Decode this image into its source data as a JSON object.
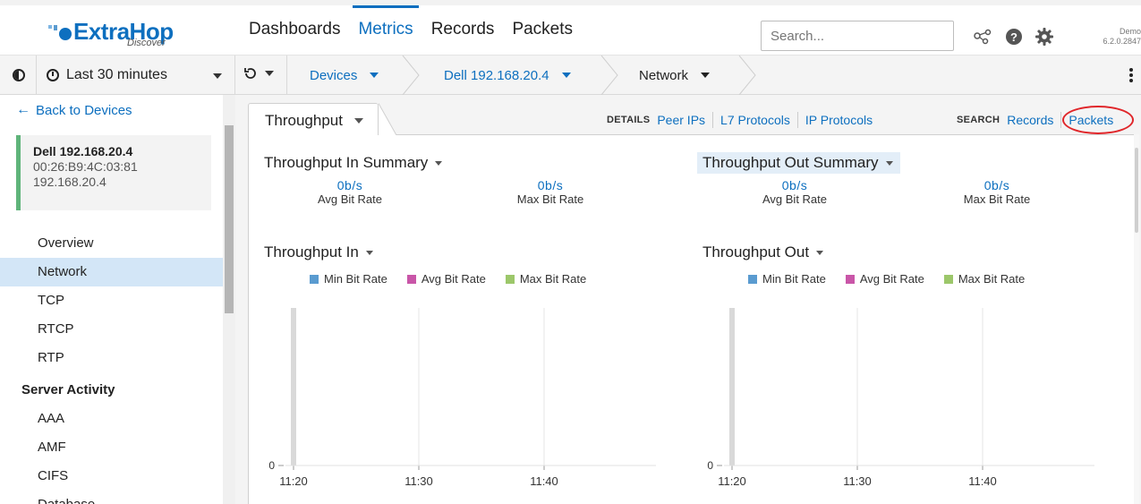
{
  "app": {
    "logo_text": "ExtraHop",
    "logo_sub": "Discover",
    "brand_color": "#0d6fbf"
  },
  "nav": {
    "items": [
      {
        "label": "Dashboards",
        "active": false
      },
      {
        "label": "Metrics",
        "active": true
      },
      {
        "label": "Records",
        "active": false
      },
      {
        "label": "Packets",
        "active": false
      }
    ],
    "search_placeholder": "Search...",
    "user_label": "Demo",
    "version": "6.2.0.2847",
    "icons": [
      "network-icon",
      "help-icon",
      "gear-icon"
    ]
  },
  "toolbar": {
    "time_range": "Last 30 minutes",
    "breadcrumbs": [
      {
        "label": "Devices"
      },
      {
        "label": "Dell 192.168.20.4"
      },
      {
        "label": "Network"
      }
    ]
  },
  "sidebar": {
    "back_label": "Back to Devices",
    "device": {
      "name": "Dell 192.168.20.4",
      "mac": "00:26:B9:4C:03:81",
      "ip": "192.168.20.4",
      "status_color": "#5fb47a"
    },
    "items": [
      {
        "label": "Overview",
        "active": false
      },
      {
        "label": "Network",
        "active": true
      },
      {
        "label": "TCP",
        "active": false
      },
      {
        "label": "RTCP",
        "active": false
      },
      {
        "label": "RTP",
        "active": false
      }
    ],
    "section_heading": "Server Activity",
    "section_items": [
      {
        "label": "AAA"
      },
      {
        "label": "AMF"
      },
      {
        "label": "CIFS"
      },
      {
        "label": "Database"
      }
    ]
  },
  "main": {
    "tab_label": "Throughput",
    "details_label": "DETAILS",
    "details_links": [
      "Peer IPs",
      "L7 Protocols",
      "IP Protocols"
    ],
    "search_label": "SEARCH",
    "search_links": [
      "Records",
      "Packets"
    ],
    "summary_in": {
      "title": "Throughput In Summary",
      "metrics": [
        {
          "value": "0b/s",
          "label": "Avg Bit Rate"
        },
        {
          "value": "0b/s",
          "label": "Max Bit Rate"
        }
      ]
    },
    "summary_out": {
      "title": "Throughput Out Summary",
      "metrics": [
        {
          "value": "0b/s",
          "label": "Avg Bit Rate"
        },
        {
          "value": "0b/s",
          "label": "Max Bit Rate"
        }
      ]
    },
    "chart_in_title": "Throughput In",
    "chart_out_title": "Throughput Out",
    "legend": [
      {
        "label": "Min Bit Rate",
        "color": "#5a9bd0"
      },
      {
        "label": "Avg Bit Rate",
        "color": "#c956a8"
      },
      {
        "label": "Max Bit Rate",
        "color": "#9cc76a"
      }
    ]
  },
  "chart_data": [
    {
      "type": "bar",
      "title": "Throughput In",
      "x": [
        "11:20",
        "11:30",
        "11:40"
      ],
      "x_ticks": [
        "11:20",
        "11:30",
        "11:40"
      ],
      "y_ticks": [
        "0"
      ],
      "series": [
        {
          "name": "Min Bit Rate",
          "values": [
            0,
            0,
            0
          ]
        },
        {
          "name": "Avg Bit Rate",
          "values": [
            0,
            0,
            0
          ]
        },
        {
          "name": "Max Bit Rate",
          "values": [
            0,
            0,
            0
          ]
        }
      ],
      "legend": "top",
      "grid": true
    },
    {
      "type": "bar",
      "title": "Throughput Out",
      "x": [
        "11:20",
        "11:30",
        "11:40"
      ],
      "x_ticks": [
        "11:20",
        "11:30",
        "11:40"
      ],
      "y_ticks": [
        "0"
      ],
      "series": [
        {
          "name": "Min Bit Rate",
          "values": [
            0,
            0,
            0
          ]
        },
        {
          "name": "Avg Bit Rate",
          "values": [
            0,
            0,
            0
          ]
        },
        {
          "name": "Max Bit Rate",
          "values": [
            0,
            0,
            0
          ]
        }
      ],
      "legend": "top",
      "grid": true
    }
  ]
}
